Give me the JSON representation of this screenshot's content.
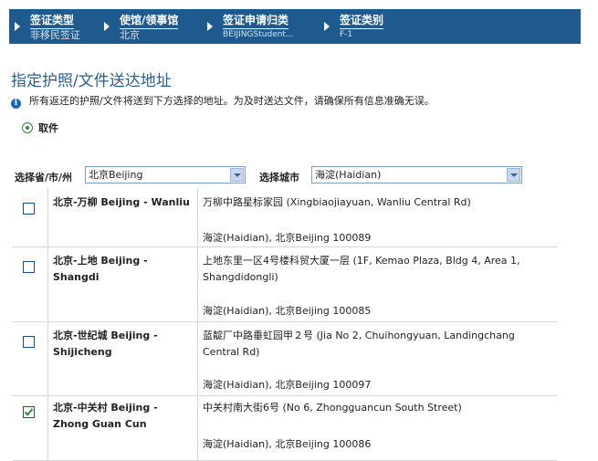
{
  "steps": [
    {
      "title": "签证类型",
      "value": "非移民签证"
    },
    {
      "title": "使馆/领事馆",
      "value": "北京"
    },
    {
      "title": "签证申请归类",
      "value": "BEIJINGStudent..."
    },
    {
      "title": "签证类别",
      "value": "F-1"
    }
  ],
  "page_title": "指定护照/文件送达地址",
  "info_text": "所有返还的护照/文件将送到下方选择的地址。为及时送达文件，请确保所有信息准确无误。",
  "pickup_option": "取件",
  "filters": {
    "province_label": "选择省/市/州",
    "province_value": "北京Beijing",
    "city_label": "选择城市",
    "city_value": "海淀(Haidian)"
  },
  "locations": [
    {
      "checked": false,
      "name": "北京-万柳 Beijing - Wanliu",
      "address": "万柳中路星标家园 (Xingbiaojiayuan, Wanliu Central Rd)",
      "city": "海淀(Haidian), 北京Beijing 100089"
    },
    {
      "checked": false,
      "name": "北京-上地 Beijing - Shangdi",
      "address": "上地东里一区4号楼科贸大厦一层 (1F, Kemao Plaza, Bldg 4, Area 1, Shangdidongli)",
      "city": "海淀(Haidian), 北京Beijing 100085"
    },
    {
      "checked": false,
      "name": "北京-世纪城 Beijing - Shijicheng",
      "address": "蓝靛厂中路垂虹园甲２号 (Jia No 2, Chuihongyuan, Landingchang Central Rd)",
      "city": "海淀(Haidian), 北京Beijing 100097"
    },
    {
      "checked": true,
      "name": "北京-中关村 Beijing - Zhong Guan Cun",
      "address": "中关村南大街6号 (No 6, Zhongguancun South Street)",
      "city": "海淀(Haidian), 北京Beijing 100086"
    }
  ],
  "colors": {
    "header_bg": "#1f5a8e",
    "title": "#2a5f8f",
    "selected_check": "#2f8a3c"
  }
}
